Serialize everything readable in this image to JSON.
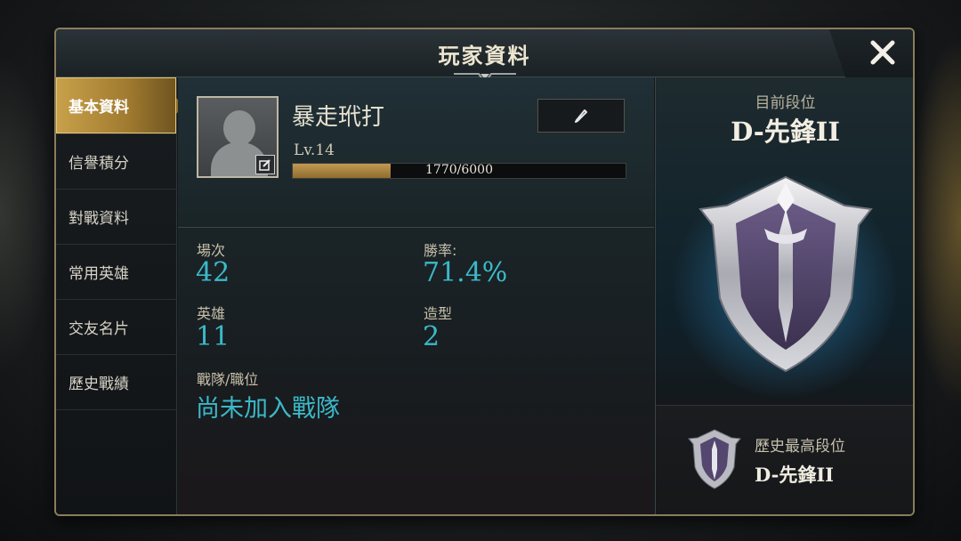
{
  "window": {
    "title": "玩家資料"
  },
  "sidebar": {
    "items": [
      {
        "label": "基本資料",
        "active": true
      },
      {
        "label": "信譽積分",
        "active": false
      },
      {
        "label": "對戰資料",
        "active": false
      },
      {
        "label": "常用英雄",
        "active": false
      },
      {
        "label": "交友名片",
        "active": false
      },
      {
        "label": "歷史戰績",
        "active": false
      }
    ]
  },
  "profile": {
    "name": "暴走玳打",
    "level": "Lv.14",
    "xp_text": "1770/6000",
    "xp_fraction": 0.295
  },
  "stats": {
    "matches_label": "場次",
    "matches_value": "42",
    "winrate_label": "勝率:",
    "winrate_value": "71.4%",
    "heroes_label": "英雄",
    "heroes_value": "11",
    "skins_label": "造型",
    "skins_value": "2",
    "team_label": "戰隊/職位",
    "team_value": "尚未加入戰隊"
  },
  "rank": {
    "current_label": "目前段位",
    "current_value": "D-先鋒II",
    "best_label": "歷史最高段位",
    "best_value": "D-先鋒II"
  },
  "colors": {
    "accent_gold": "#c9a14b",
    "stat_cyan": "#3bb9c9"
  },
  "icons": {
    "close": "close-icon",
    "edit": "pencil-icon",
    "avatar_edit": "edit-square-icon"
  }
}
